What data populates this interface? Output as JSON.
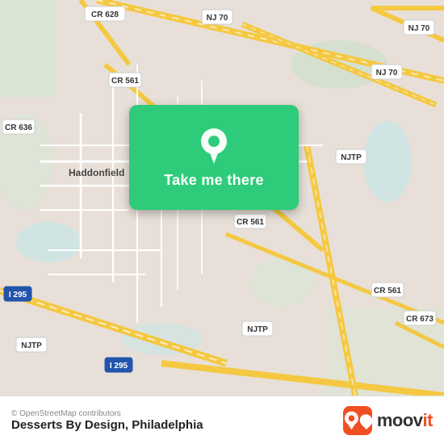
{
  "map": {
    "attribution": "© OpenStreetMap contributors",
    "center": "Haddonfield, Philadelphia area",
    "background_color": "#e8e0d8"
  },
  "card": {
    "label": "Take me there",
    "background_color": "#2ecc7a"
  },
  "bottom_bar": {
    "place_name": "Desserts By Design, Philadelphia",
    "moovit_text": "moovit"
  },
  "roads": {
    "highway_color": "#f5c842",
    "road_color": "#ffffff",
    "minor_road_color": "#f0ebe3"
  }
}
